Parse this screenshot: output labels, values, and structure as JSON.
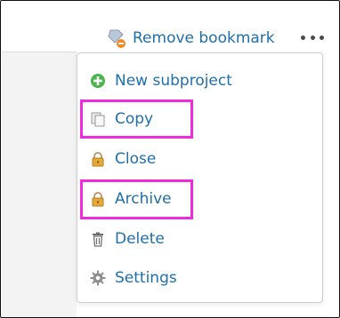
{
  "toolbar": {
    "remove_bookmark_label": "Remove bookmark",
    "remove_bookmark_icon": "bookmark-remove-icon",
    "more_icon": "ellipsis-icon"
  },
  "menu": {
    "items": [
      {
        "label": "New subproject",
        "icon": "add-circle-icon"
      },
      {
        "label": "Copy",
        "icon": "copy-icon"
      },
      {
        "label": "Close",
        "icon": "lock-icon"
      },
      {
        "label": "Archive",
        "icon": "lock-icon"
      },
      {
        "label": "Delete",
        "icon": "trash-icon"
      },
      {
        "label": "Settings",
        "icon": "gear-icon"
      }
    ],
    "highlighted_items": [
      "Copy",
      "Archive"
    ]
  },
  "colors": {
    "link": "#1f6fa8",
    "highlight": "#ee2bdf",
    "add_green": "#4cb64c",
    "lock_gold": "#e5a93a"
  }
}
